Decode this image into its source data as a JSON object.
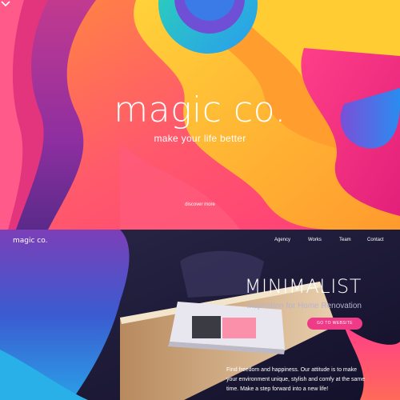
{
  "hero": {
    "title": "magic co.",
    "subtitle": "make your life better",
    "discover_label": "discover more",
    "icons": {
      "discover": "chevron-down-icon"
    },
    "colors": [
      "#ff4f6e",
      "#ffb830",
      "#ff7a3c",
      "#c9339c",
      "#7b4fd6",
      "#2ad8b0",
      "#2aa8f0",
      "#e8349a"
    ]
  },
  "site": {
    "logo": "magic co.",
    "nav": [
      "Agency",
      "Works",
      "Team",
      "Contact"
    ],
    "headline": "MINIMALIST",
    "tagline": "Inspiration for Home Renovation",
    "cta_label": "GO TO WEBSITE",
    "body": "Find freedom and happiness. Our attitude is to make your environment unique, stylish and comfy at the same time. Make a step forward into a new life!",
    "colors": {
      "cta": "#ee3a87",
      "background": "#16132e"
    }
  }
}
